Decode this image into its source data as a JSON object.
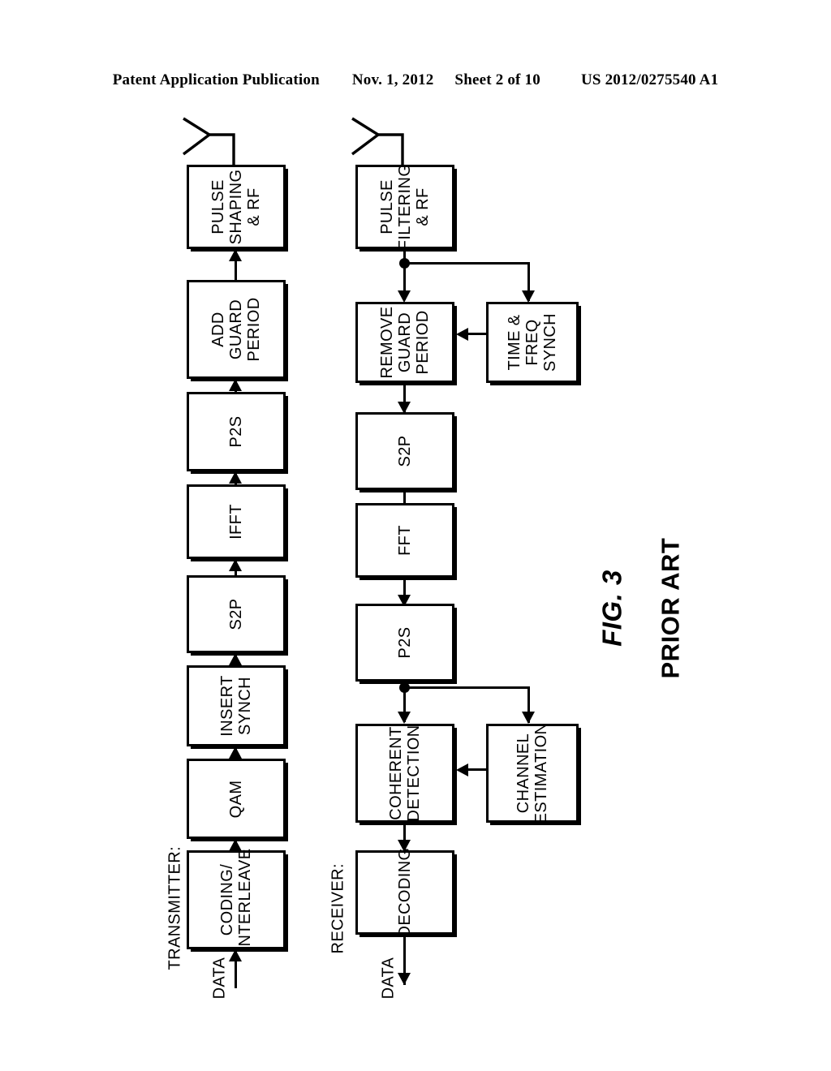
{
  "header": {
    "publication": "Patent Application Publication",
    "date": "Nov. 1, 2012",
    "sheet": "Sheet 2 of 10",
    "number": "US 2012/0275540 A1"
  },
  "figure": {
    "label": "FIG. 3",
    "note": "PRIOR ART"
  },
  "sections": {
    "transmitter_label": "TRANSMITTER:",
    "receiver_label": "RECEIVER:"
  },
  "signals": {
    "tx_input": "DATA",
    "rx_output": "DATA"
  },
  "icons": {
    "tx_antenna": "antenna-icon",
    "rx_antenna": "antenna-icon"
  },
  "transmitter_chain": [
    {
      "id": "coding-interleave",
      "label": "CODING/\nINTERLEAVE"
    },
    {
      "id": "qam",
      "label": "QAM"
    },
    {
      "id": "insert-synch",
      "label": "INSERT\nSYNCH"
    },
    {
      "id": "s2p",
      "label": "S2P"
    },
    {
      "id": "ifft",
      "label": "IFFT"
    },
    {
      "id": "p2s",
      "label": "P2S"
    },
    {
      "id": "add-guard-period",
      "label": "ADD\nGUARD\nPERIOD"
    },
    {
      "id": "pulse-shaping-rf",
      "label": "PULSE\nSHAPING\n& RF"
    }
  ],
  "receiver_chain": [
    {
      "id": "pulse-filtering-rf",
      "label": "PULSE\nFILTERING\n& RF"
    },
    {
      "id": "remove-guard-period",
      "label": "REMOVE\nGUARD\nPERIOD"
    },
    {
      "id": "s2p",
      "label": "S2P"
    },
    {
      "id": "fft",
      "label": "FFT"
    },
    {
      "id": "p2s",
      "label": "P2S"
    },
    {
      "id": "coherent-detection",
      "label": "COHERENT\nDETECTION"
    },
    {
      "id": "decoding",
      "label": "DECODING"
    }
  ],
  "receiver_side_blocks": [
    {
      "id": "time-freq-synch",
      "label": "TIME &\nFREQ\nSYNCH"
    },
    {
      "id": "channel-estimation",
      "label": "CHANNEL\nESTIMATION"
    }
  ],
  "colors": {
    "stroke": "#000000",
    "fill": "#ffffff"
  }
}
